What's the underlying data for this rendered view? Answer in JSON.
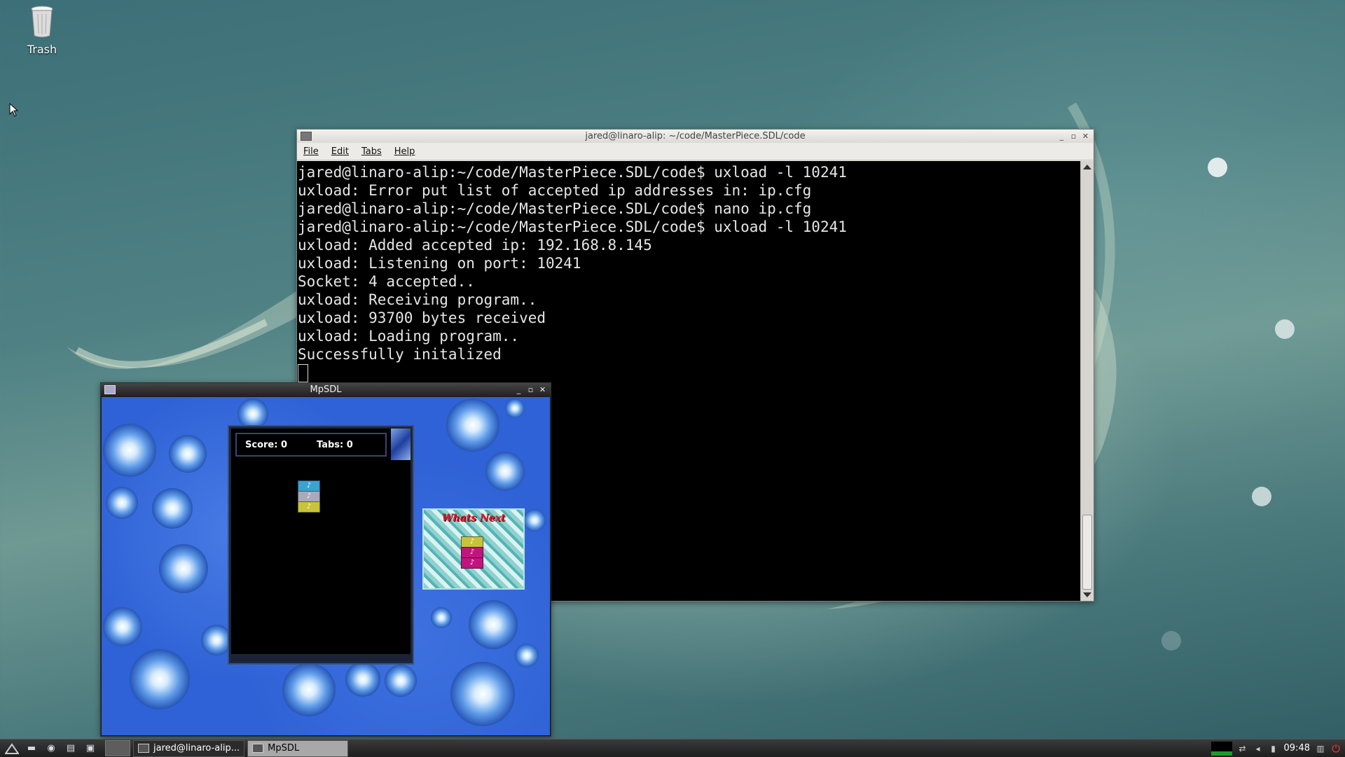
{
  "desktop": {
    "trash_label": "Trash"
  },
  "terminal": {
    "title": "jared@linaro-alip: ~/code/MasterPiece.SDL/code",
    "menu": [
      "File",
      "Edit",
      "Tabs",
      "Help"
    ],
    "lines": [
      "jared@linaro-alip:~/code/MasterPiece.SDL/code$ uxload -l 10241",
      "uxload: Error put list of accepted ip addresses in: ip.cfg",
      "jared@linaro-alip:~/code/MasterPiece.SDL/code$ nano ip.cfg",
      "jared@linaro-alip:~/code/MasterPiece.SDL/code$ uxload -l 10241",
      "uxload: Added accepted ip: 192.168.8.145",
      "uxload: Listening on port: 10241",
      "Socket: 4 accepted..",
      "uxload: Receiving program..",
      "uxload: 93700 bytes received",
      "uxload: Loading program..",
      "Successfully initalized"
    ]
  },
  "game_window": {
    "title": "MpSDL",
    "score_text": "Score: 0",
    "tabs_text": "Tabs: 0",
    "next_label": "Whats Next"
  },
  "taskbar": {
    "task_terminal": "jared@linaro-alip...",
    "task_game": "MpSDL",
    "clock": "09:48"
  },
  "colors": {
    "desktop_accent": "#4f8184",
    "game_background": "#2f62d6",
    "block_cyan": "#3aa3d0",
    "block_silver": "#a9a9b8",
    "block_yellow": "#c9c33a",
    "block_magenta": "#c0157f"
  }
}
